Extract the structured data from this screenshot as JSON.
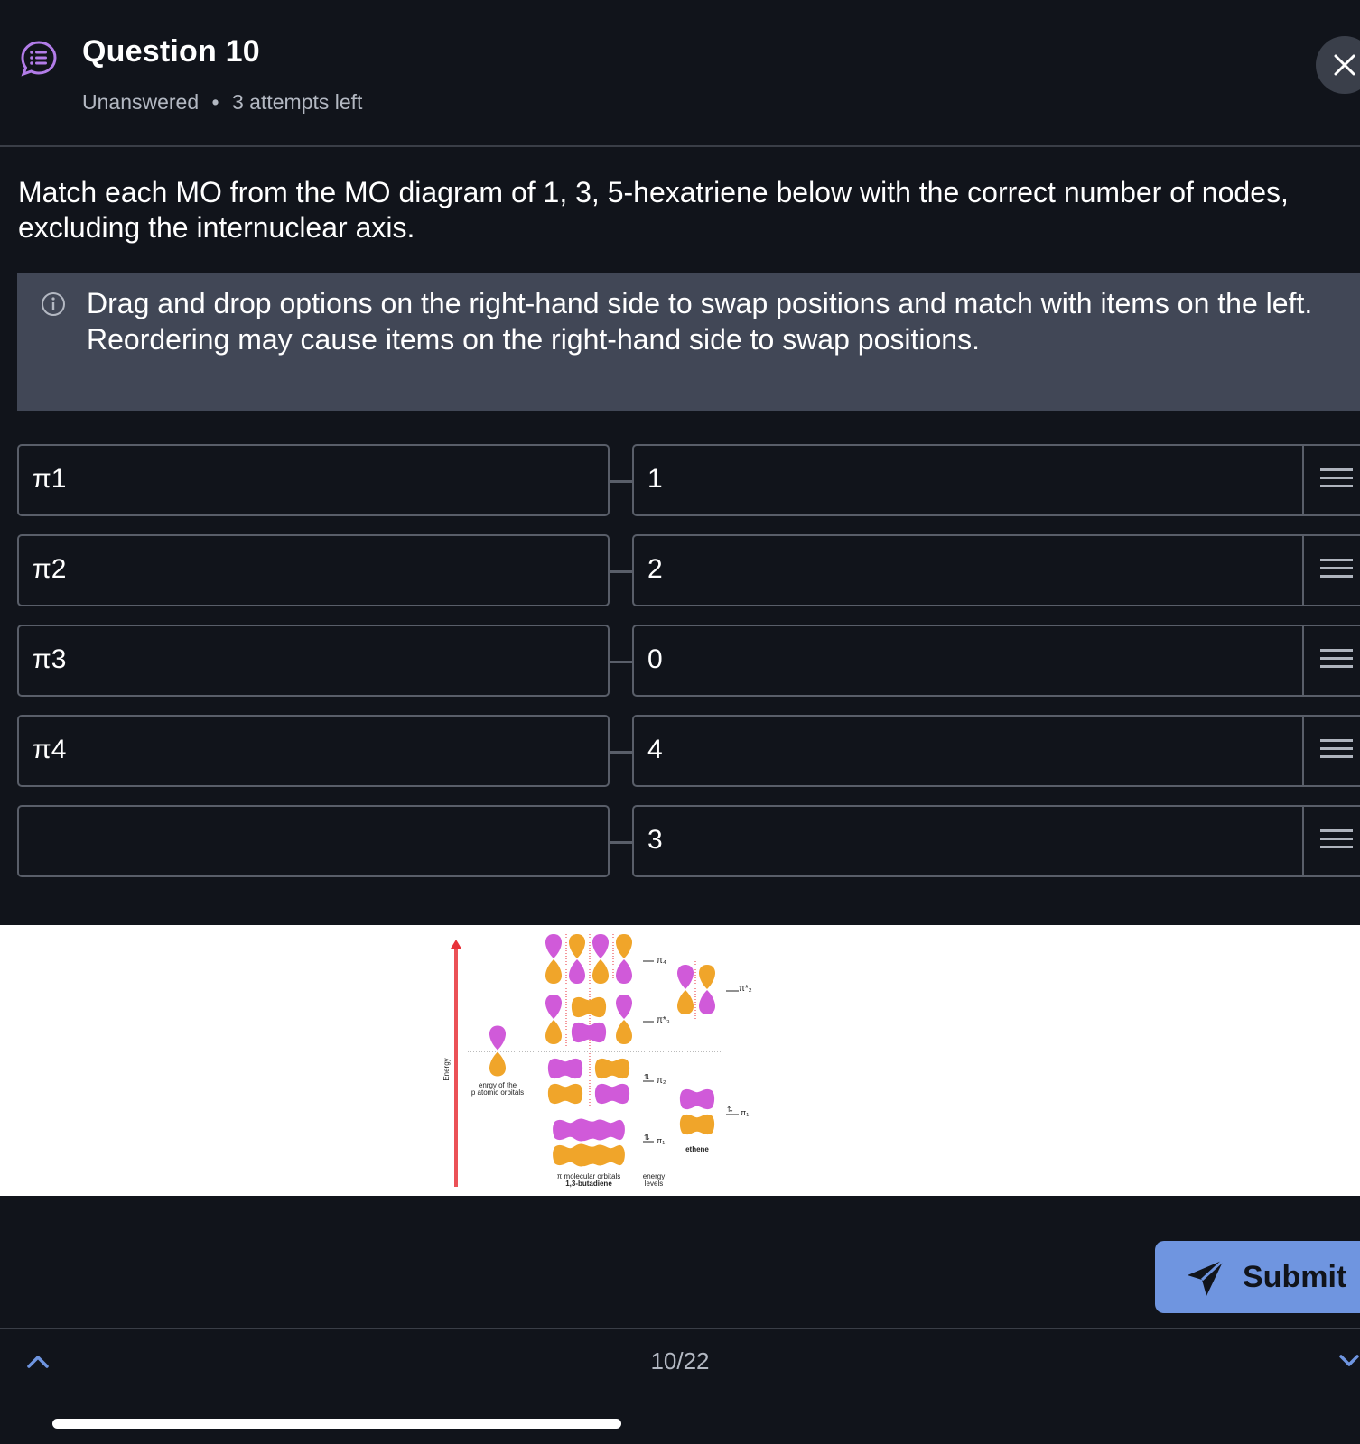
{
  "header": {
    "title": "Question 10",
    "status": "Unanswered",
    "separator": "•",
    "attempts": "3 attempts left"
  },
  "prompt": "Match each MO from the MO diagram of 1, 3, 5-hexatriene below with the correct number of nodes, excluding the internuclear axis.",
  "hint": {
    "line1": "Drag and drop options on the right-hand side to swap positions and match with items on the left.",
    "line2": "Reordering may cause items on the right-hand side to swap positions."
  },
  "match": {
    "left": [
      "π1",
      "π2",
      "π3",
      "π4",
      ""
    ],
    "right": [
      "1",
      "2",
      "0",
      "4",
      "3"
    ]
  },
  "diagram": {
    "energy_axis": "Energy",
    "atomic_label_1": "enrgy of the",
    "atomic_label_2": "p atomic orbitals",
    "mo_label_1": "π molecular orbitals",
    "mo_label_2": "1,3-butadiene",
    "levels_label_1": "energy",
    "levels_label_2": "levels",
    "ethene_label": "ethene",
    "pi4": "π₄",
    "pi3": "π*₃",
    "pi2": "π₂",
    "pi1": "π₁",
    "ethene_pi2": "π*₂",
    "ethene_pi1": "π₁",
    "electron_pair": "⇅",
    "colors": {
      "lobe_a": "#d05ad9",
      "lobe_b": "#f0a52a",
      "arrow": "#e8323a"
    }
  },
  "submit_label": "Submit",
  "pager": "10/22",
  "icons": [
    "question-list-icon",
    "close-icon",
    "info-icon",
    "drag-handle-icon",
    "send-icon",
    "chevron-up-icon",
    "chevron-down-icon"
  ]
}
